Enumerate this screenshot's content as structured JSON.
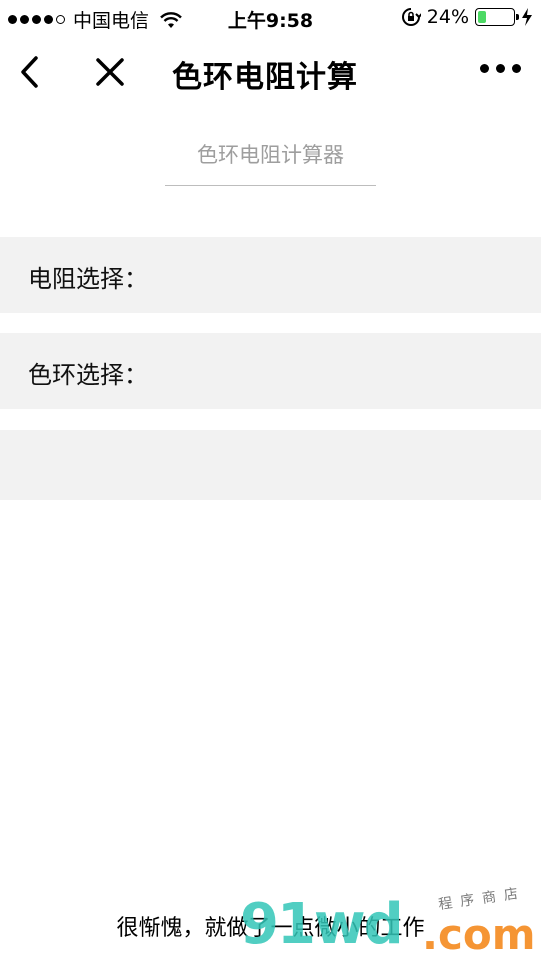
{
  "status_bar": {
    "carrier": "中国电信",
    "time": "上午9:58",
    "battery_percent": "24%",
    "battery_level": 0.24,
    "icons": [
      "signal-dots-icon",
      "wifi-icon",
      "rotation-lock-icon",
      "battery-icon",
      "charging-icon"
    ]
  },
  "nav": {
    "title": "色环电阻计算",
    "icons": [
      "back-chevron-icon",
      "close-icon",
      "more-dots-icon"
    ]
  },
  "main": {
    "heading": "色环电阻计算器",
    "resistor_select_label": "电阻选择：",
    "color_ring_select_label": "色环选择："
  },
  "footer": {
    "text": "很惭愧，就做了一点微小的工作"
  },
  "watermark": {
    "logo_main": "91wd",
    "logo_domain": ".com",
    "logo_tagline": "程序商店"
  },
  "colors": {
    "row_background": "#f2f2f2",
    "heading_gray": "#9e9e9e",
    "battery_green": "#4cd964",
    "watermark_teal": "#33c6b8",
    "watermark_orange": "#f58a1f"
  }
}
